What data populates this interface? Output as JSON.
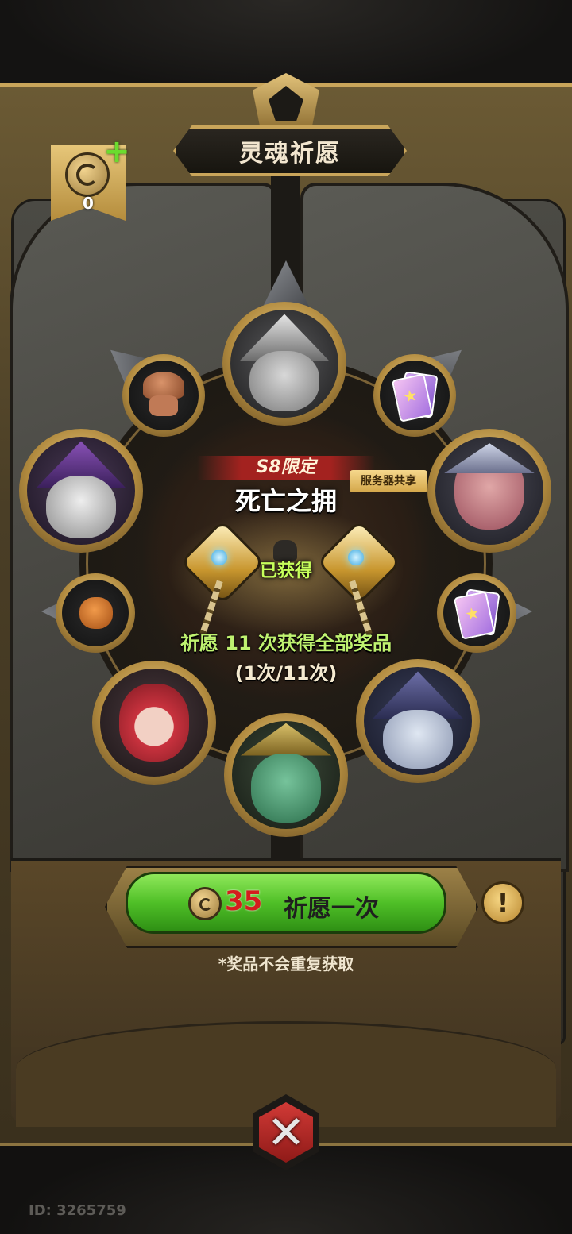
{
  "title": "灵魂祈愿",
  "currency": {
    "icon": "soul-coin-icon",
    "count": "0"
  },
  "event": {
    "season_tag": "S8限定",
    "name": "死亡之拥",
    "server_tag": "服务器共享",
    "obtained_label": "已获得",
    "progress_text": "祈愿 11 次获得全部奖品",
    "progress_count": "(1次/11次)"
  },
  "prizes": [
    {
      "name": "witch-hunter-hero-portrait"
    },
    {
      "name": "card-pack-icon"
    },
    {
      "name": "bear-hero-portrait"
    },
    {
      "name": "card-pack-icon"
    },
    {
      "name": "wizard-hero-portrait"
    },
    {
      "name": "green-warrior-hero-portrait"
    },
    {
      "name": "red-hair-hero-portrait"
    },
    {
      "name": "pumpkin-costume-icon"
    },
    {
      "name": "purple-witch-hero-portrait"
    },
    {
      "name": "mushroom-pet-icon"
    }
  ],
  "pray_button": {
    "cost": "35",
    "label": "祈愿一次"
  },
  "note": "*奖品不会重复获取",
  "player_id": "ID: 3265759",
  "colors": {
    "accent_gold": "#c9a55a",
    "button_green": "#4fbf27",
    "cost_red": "#d41d1d",
    "progress_green": "#bff270"
  }
}
